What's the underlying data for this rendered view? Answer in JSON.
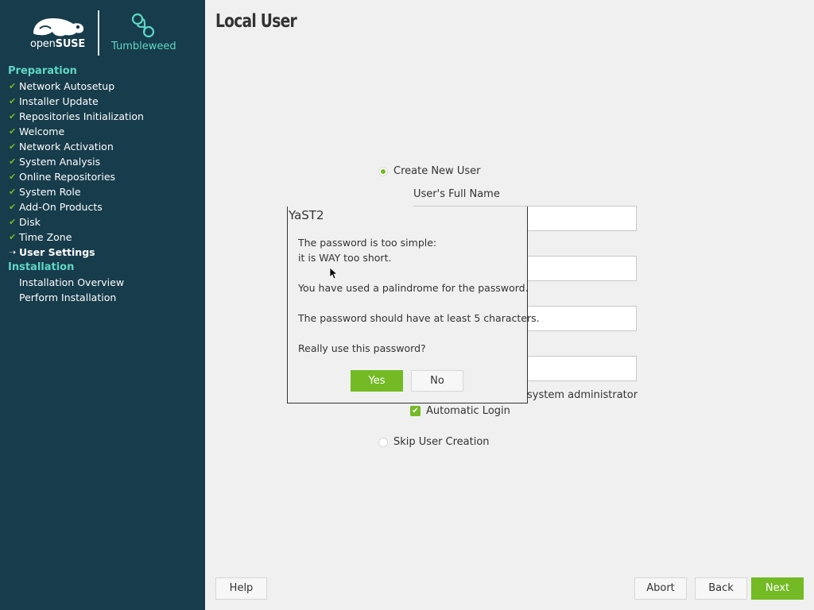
{
  "branding": {
    "suse_prefix": "open",
    "suse_name": "SUSE",
    "tumbleweed": "Tumbleweed"
  },
  "sidebar": {
    "sections": [
      {
        "heading": "Preparation",
        "steps": [
          {
            "label": "Network Autosetup",
            "status": "done"
          },
          {
            "label": "Installer Update",
            "status": "done"
          },
          {
            "label": "Repositories Initialization",
            "status": "done"
          },
          {
            "label": "Welcome",
            "status": "done"
          },
          {
            "label": "Network Activation",
            "status": "done"
          },
          {
            "label": "System Analysis",
            "status": "done"
          },
          {
            "label": "Online Repositories",
            "status": "done"
          },
          {
            "label": "System Role",
            "status": "done"
          },
          {
            "label": "Add-On Products",
            "status": "done"
          },
          {
            "label": "Disk",
            "status": "done"
          },
          {
            "label": "Time Zone",
            "status": "done"
          },
          {
            "label": "User Settings",
            "status": "current"
          }
        ]
      },
      {
        "heading": "Installation",
        "steps": [
          {
            "label": "Installation Overview",
            "status": "pending"
          },
          {
            "label": "Perform Installation",
            "status": "pending"
          }
        ]
      }
    ]
  },
  "main": {
    "title": "Local User",
    "create_user_label": "Create New User",
    "full_name_label": "User's Full Name",
    "admin_label_partial": "system administrator",
    "auto_login_label": "Automatic Login",
    "skip_label": "Skip User Creation"
  },
  "dialog": {
    "title": "YaST2",
    "lines": [
      "The password is too simple:",
      "it is WAY too short.",
      "You have used a palindrome for the password.",
      "The password should have at least 5 characters.",
      "Really use this password?"
    ],
    "yes_label": "Yes",
    "no_label": "No"
  },
  "footer": {
    "help_label": "Help",
    "abort_label": "Abort",
    "back_label": "Back",
    "next_label": "Next"
  },
  "colors": {
    "sidebar_bg": "#173c4b",
    "accent_green": "#73ba25",
    "heading_teal": "#5ed7c5"
  }
}
